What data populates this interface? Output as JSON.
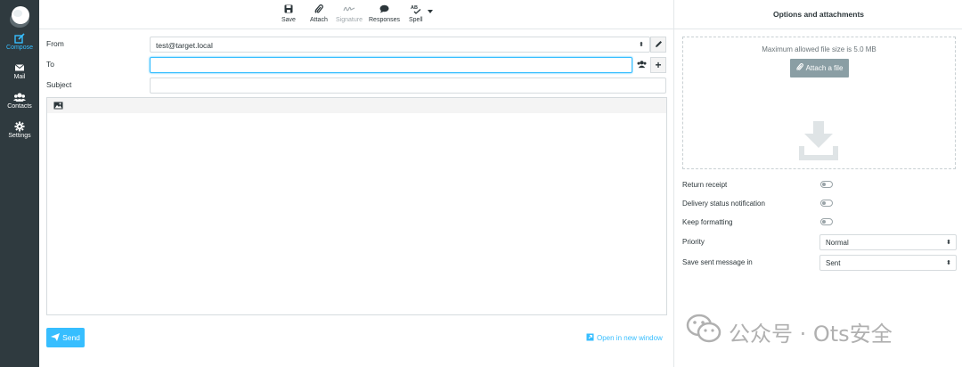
{
  "nav": {
    "items": [
      {
        "label": "Compose",
        "icon": "compose-icon"
      },
      {
        "label": "Mail",
        "icon": "mail-icon"
      },
      {
        "label": "Contacts",
        "icon": "contacts-icon"
      },
      {
        "label": "Settings",
        "icon": "gear-icon"
      }
    ]
  },
  "toolbar": {
    "save": "Save",
    "attach": "Attach",
    "signature": "Signature",
    "responses": "Responses",
    "spell": "Spell"
  },
  "form": {
    "from_label": "From",
    "from_value": "test@target.local",
    "to_label": "To",
    "to_value": "",
    "subject_label": "Subject",
    "subject_value": ""
  },
  "actions": {
    "send": "Send",
    "open_new_window": "Open in new window"
  },
  "options": {
    "title": "Options and attachments",
    "max_size": "Maximum allowed file size is 5.0 MB",
    "attach_file": "Attach a file",
    "return_receipt": "Return receipt",
    "delivery_status": "Delivery status notification",
    "keep_formatting": "Keep formatting",
    "priority_label": "Priority",
    "priority_value": "Normal",
    "save_sent_label": "Save sent message in",
    "save_sent_value": "Sent"
  },
  "watermark": {
    "text": "公众号 · Ots安全"
  },
  "colors": {
    "accent": "#37beff",
    "nav_bg": "#2f3a3f"
  }
}
